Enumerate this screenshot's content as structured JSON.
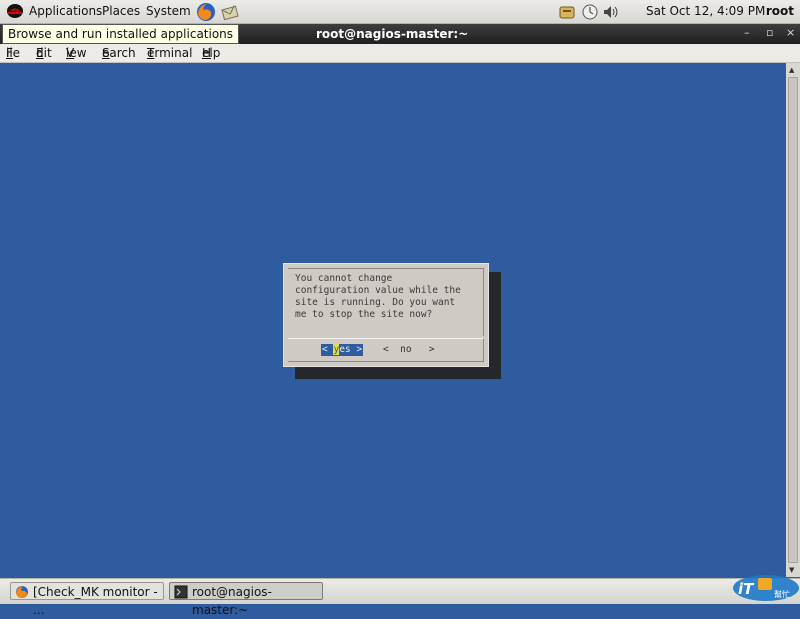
{
  "topbar": {
    "menus": [
      "Applications",
      "Places",
      "System"
    ],
    "clock": "Sat Oct 12,  4:09 PM",
    "user": "root",
    "tooltip": "Browse and run installed applications"
  },
  "window": {
    "title": "root@nagios-master:~",
    "controls": [
      "–",
      "▫",
      "×"
    ]
  },
  "menubar": {
    "items": [
      {
        "label": "File",
        "ul": "F",
        "rest": "ile"
      },
      {
        "label": "Edit",
        "ul": "E",
        "rest": "dit"
      },
      {
        "label": "View",
        "ul": "V",
        "rest": "iew"
      },
      {
        "label": "Search",
        "ul": "S",
        "rest": "earch"
      },
      {
        "label": "Terminal",
        "ul": "T",
        "rest": "erminal"
      },
      {
        "label": "Help",
        "ul": "H",
        "rest": "elp"
      }
    ]
  },
  "dialog": {
    "message": "You cannot change\nconfiguration value while the\nsite is running. Do you want\nme to stop the site now?",
    "yes_left": "< ",
    "yes_hot": "y",
    "yes_right": "es >",
    "no": "<  no   >"
  },
  "taskbar": {
    "tasks": [
      {
        "label": "[Check_MK monitor - ..."
      },
      {
        "label": "root@nagios-master:~"
      }
    ]
  },
  "watermark": {
    "text": "iT邦幫忙"
  },
  "colors": {
    "terminal_bg": "#2f5c9f",
    "dialog_bg": "#cfcbc4",
    "highlight": "#e8e03a"
  }
}
